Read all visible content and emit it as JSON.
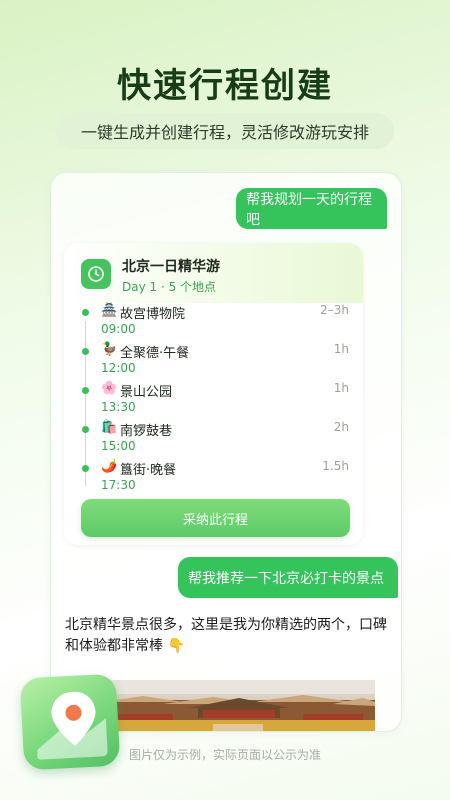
{
  "header": {
    "title": "快速行程创建",
    "subtitle": "一键生成并创建行程，灵活修改游玩安排"
  },
  "chat": {
    "user_msg_1": "帮我规划一天的行程吧",
    "trip_card": {
      "title": "北京一日精华游",
      "meta": "Day 1 · 5 个地点",
      "stops": [
        {
          "icon": "🏯",
          "name": "故宫博物院",
          "duration": "2–3h",
          "time": "09:00"
        },
        {
          "icon": "🦆",
          "name": "全聚德·午餐",
          "duration": "1h",
          "time": "12:00"
        },
        {
          "icon": "🌸",
          "name": "景山公园",
          "duration": "1h",
          "time": "13:30"
        },
        {
          "icon": "🛍️",
          "name": "南锣鼓巷",
          "duration": "2h",
          "time": "15:00"
        },
        {
          "icon": "🌶️",
          "name": "簋街·晚餐",
          "duration": "1.5h",
          "time": "17:30"
        }
      ],
      "adopt_label": "采纳此行程"
    },
    "user_msg_2": "帮我推荐一下北京必打卡的景点",
    "bot_msg": "北京精华景点很多，这里是我为你精选的两个，口碑和体验都非常棒 👇"
  },
  "footer": {
    "note": "图片仅为示例，实际页面以公示为准"
  },
  "icons": {
    "trip_card_icon": "clock-icon",
    "badge_icon": "map-pin-icon"
  },
  "colors": {
    "accent": "#35c35b",
    "title": "#173c17"
  }
}
